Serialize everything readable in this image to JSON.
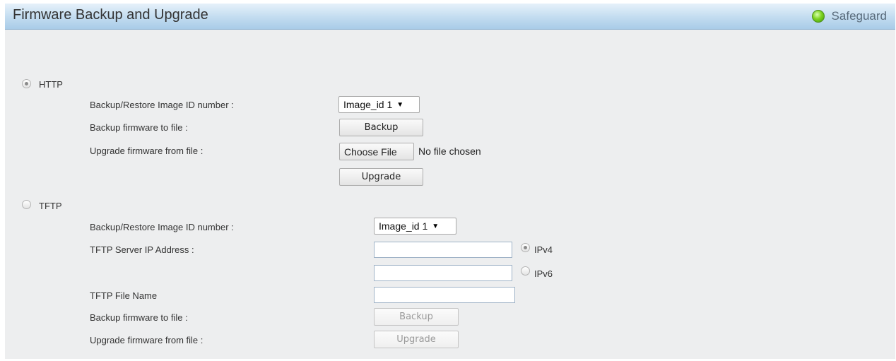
{
  "header": {
    "title": "Firmware Backup and Upgrade",
    "safeguard_label": "Safeguard",
    "safeguard_status_color": "#7ed321"
  },
  "http": {
    "label": "HTTP",
    "selected": true,
    "image_id_label": "Backup/Restore Image ID number :",
    "image_id_value": "Image_id 1",
    "backup_label": "Backup firmware to file :",
    "backup_button": "Backup",
    "upgrade_label": "Upgrade firmware from file :",
    "choose_file_button": "Choose File",
    "file_status": "No file chosen",
    "upgrade_button": "Upgrade"
  },
  "tftp": {
    "label": "TFTP",
    "selected": false,
    "image_id_label": "Backup/Restore Image ID number :",
    "image_id_value": "Image_id 1",
    "server_ip_label": "TFTP Server IP Address :",
    "ipv4_value": "",
    "ipv4_label": "IPv4",
    "ipv4_selected": true,
    "ipv6_value": "",
    "ipv6_label": "IPv6",
    "ipv6_selected": false,
    "file_name_label": "TFTP File Name",
    "file_name_value": "",
    "backup_label": "Backup firmware to file :",
    "backup_button": "Backup",
    "upgrade_label": "Upgrade firmware from file :",
    "upgrade_button": "Upgrade"
  }
}
